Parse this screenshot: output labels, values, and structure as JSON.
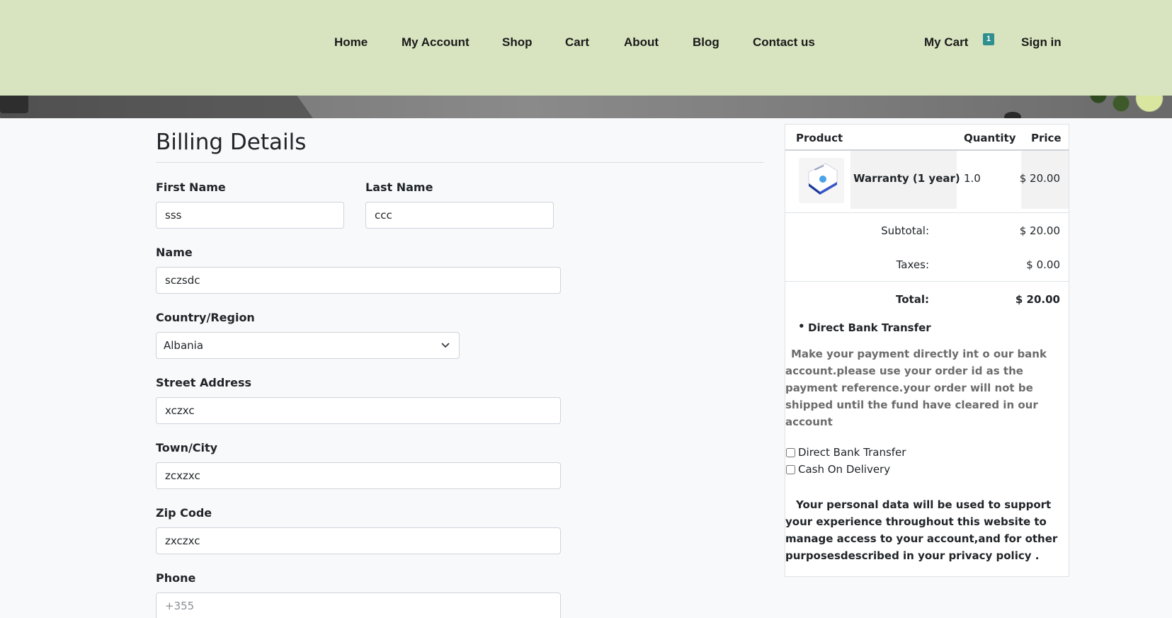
{
  "nav": {
    "links": [
      "Home",
      "My Account",
      "Shop",
      "Cart",
      "About",
      "Blog",
      "Contact us"
    ],
    "my_cart_label": "My Cart",
    "cart_count": "1",
    "sign_in_label": "Sign in"
  },
  "billing": {
    "title": "Billing Details",
    "first_name": {
      "label": "First Name",
      "value": "sss"
    },
    "last_name": {
      "label": "Last Name",
      "value": "ccc"
    },
    "name": {
      "label": "Name",
      "value": "sczsdc"
    },
    "country": {
      "label": "Country/Region",
      "value": "Albania"
    },
    "street": {
      "label": "Street Address",
      "value": "xczxc"
    },
    "city": {
      "label": "Town/City",
      "value": "zcxzxc"
    },
    "zip": {
      "label": "Zip Code",
      "value": "zxczxc"
    },
    "phone": {
      "label": "Phone",
      "value": "",
      "placeholder": "+355"
    }
  },
  "order": {
    "headers": {
      "product": "Product",
      "quantity": "Quantity",
      "price": "Price"
    },
    "item": {
      "name": "Warranty (1 year)",
      "quantity": "1.0",
      "price": "$ 20.00",
      "thumb_icon": "warranty-box-icon"
    },
    "subtotal": {
      "label": "Subtotal:",
      "value": "$ 20.00"
    },
    "taxes": {
      "label": "Taxes:",
      "value": "$ 0.00"
    },
    "total": {
      "label": "Total:",
      "value": "$ 20.00"
    },
    "payment_heading": "Direct Bank Transfer",
    "payment_description": "Make your payment directly int o our bank account.please use your order id as the payment reference.your order will not be shipped until the fund have cleared in our account",
    "payment_options": [
      "Direct Bank Transfer",
      "Cash On Delivery"
    ],
    "privacy_note": "Your personal data will be used to support your experience throughout this website to manage access to your account,and for other purposesdescribed in your privacy policy ."
  },
  "colors": {
    "navbar_bg": "#d8e4c0",
    "badge_bg": "#2f8f8f",
    "page_bg": "#f8f9fa"
  }
}
